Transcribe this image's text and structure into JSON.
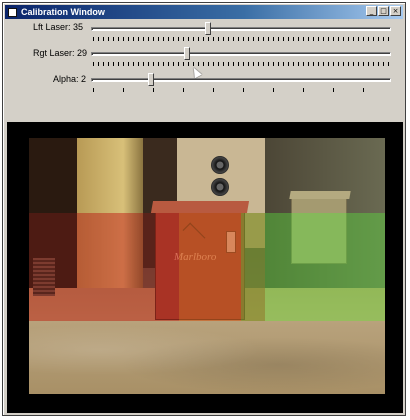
{
  "window": {
    "title": "Calibration Window",
    "buttons": [
      {
        "name": "minimize-button",
        "glyph": "_"
      },
      {
        "name": "maximize-button",
        "glyph": "□"
      },
      {
        "name": "close-button",
        "glyph": "×"
      }
    ]
  },
  "sliders": [
    {
      "id": "left-laser",
      "label": "Lft Laser: 35",
      "value_fraction": 0.39
    },
    {
      "id": "right-laser",
      "label": "Rgt Laser: 29",
      "value_fraction": 0.32
    },
    {
      "id": "alpha",
      "label": "Alpha: 2",
      "value_fraction": 0.2
    }
  ],
  "viewer": {
    "tint_colors": {
      "left": "#c8281e",
      "right": "#5ae63c"
    },
    "scene_colors": {
      "box_left": "#a84a34",
      "box_right": "#a49a70"
    }
  }
}
